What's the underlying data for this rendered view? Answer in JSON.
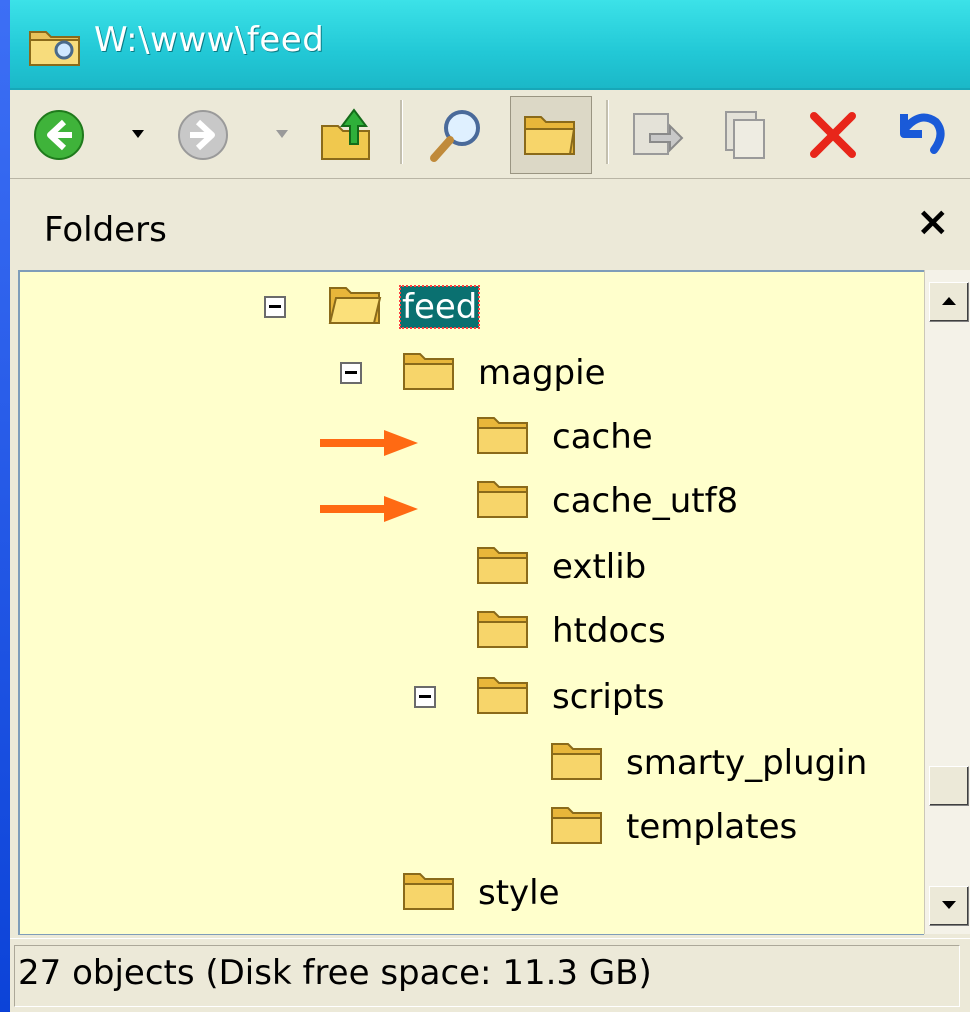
{
  "window": {
    "title": "W:\\www\\feed"
  },
  "toolbar": {
    "buttons": [
      {
        "name": "back-button",
        "icon": "back-arrow-icon"
      },
      {
        "name": "back-dropdown",
        "icon": "dropdown-icon"
      },
      {
        "name": "forward-button",
        "icon": "forward-arrow-icon"
      },
      {
        "name": "forward-dropdown",
        "icon": "dropdown-icon"
      },
      {
        "name": "up-folder-button",
        "icon": "up-folder-icon"
      },
      {
        "name": "search-button",
        "icon": "search-icon"
      },
      {
        "name": "folders-button",
        "icon": "folder-icon"
      },
      {
        "name": "move-to-button",
        "icon": "move-to-icon"
      },
      {
        "name": "copy-to-button",
        "icon": "copy-to-icon"
      },
      {
        "name": "delete-button",
        "icon": "delete-icon"
      },
      {
        "name": "undo-button",
        "icon": "undo-icon"
      }
    ]
  },
  "folders_pane": {
    "title": "Folders",
    "close_label": "×",
    "tree": [
      {
        "label": "feed",
        "expanded": true,
        "selected": true
      },
      {
        "label": "magpie",
        "expanded": true
      },
      {
        "label": "cache",
        "annotated": true
      },
      {
        "label": "cache_utf8",
        "annotated": true
      },
      {
        "label": "extlib"
      },
      {
        "label": "htdocs"
      },
      {
        "label": "scripts",
        "expanded": true
      },
      {
        "label": "smarty_plugin"
      },
      {
        "label": "templates"
      },
      {
        "label": "style"
      }
    ]
  },
  "status": {
    "text": "27 objects (Disk free space: 11.3 GB)"
  },
  "colors": {
    "titlebar": "#22c8d6",
    "tree_background": "#ffffcc",
    "selection": "#0a7070",
    "annotation_arrow": "#ff6a13",
    "desktop": "#0a3fd6"
  }
}
